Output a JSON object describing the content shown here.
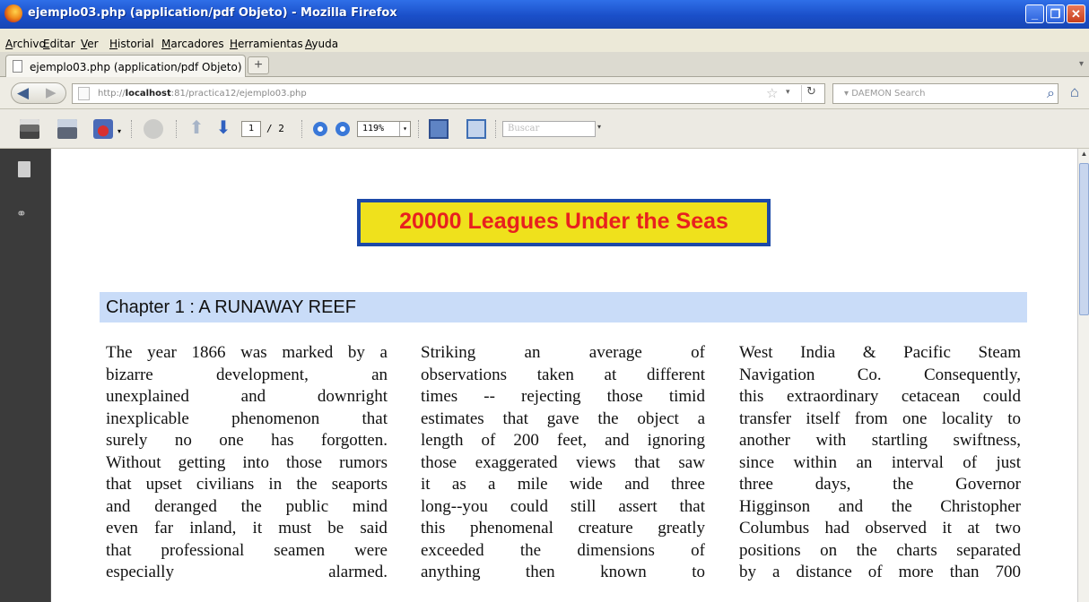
{
  "window": {
    "title": "ejemplo03.php (application/pdf Objeto) - Mozilla Firefox"
  },
  "menu": [
    "Archivo",
    "Editar",
    "Ver",
    "Historial",
    "Marcadores",
    "Herramientas",
    "Ayuda"
  ],
  "tab": {
    "label": "ejemplo03.php (application/pdf Objeto)",
    "new_tab": "+"
  },
  "nav": {
    "url_prefix": "http://",
    "url_host": "localhost",
    "url_rest": ":81/practica12/ejemplo03.php",
    "search_placeholder": "DAEMON Search"
  },
  "pdf_toolbar": {
    "page_current": "1",
    "page_total": "/ 2",
    "zoom": "119%",
    "find_placeholder": "Buscar"
  },
  "document": {
    "title": "20000 Leagues Under the Seas",
    "chapter": "Chapter  1 : A RUNAWAY REEF",
    "columns": [
      [
        "The year 1866 was marked by a",
        "bizarre development, an",
        "unexplained and downright",
        "inexplicable phenomenon that",
        "surely no one has forgotten.",
        "Without getting into those rumors",
        "that upset civilians in the seaports",
        "and deranged the public mind",
        "even far inland, it must be said",
        "that professional seamen were",
        "especially alarmed."
      ],
      [
        "Striking an average of",
        "observations taken at different",
        "times -- rejecting those timid",
        "estimates that gave the object a",
        "length of 200 feet, and ignoring",
        "those exaggerated views that saw",
        "it as a mile wide and three",
        "long--you could still assert that",
        "this phenomenal creature greatly",
        "exceeded the dimensions of",
        "anything then known to"
      ],
      [
        "West India & Pacific Steam",
        "Navigation Co. Consequently,",
        "this extraordinary cetacean could",
        "transfer itself from one locality to",
        "another with startling swiftness,",
        "since within an interval of just",
        "three days, the Governor",
        "Higginson and the Christopher",
        "Columbus had observed it at two",
        "positions on the charts separated",
        "by a distance of more than 700"
      ]
    ]
  }
}
